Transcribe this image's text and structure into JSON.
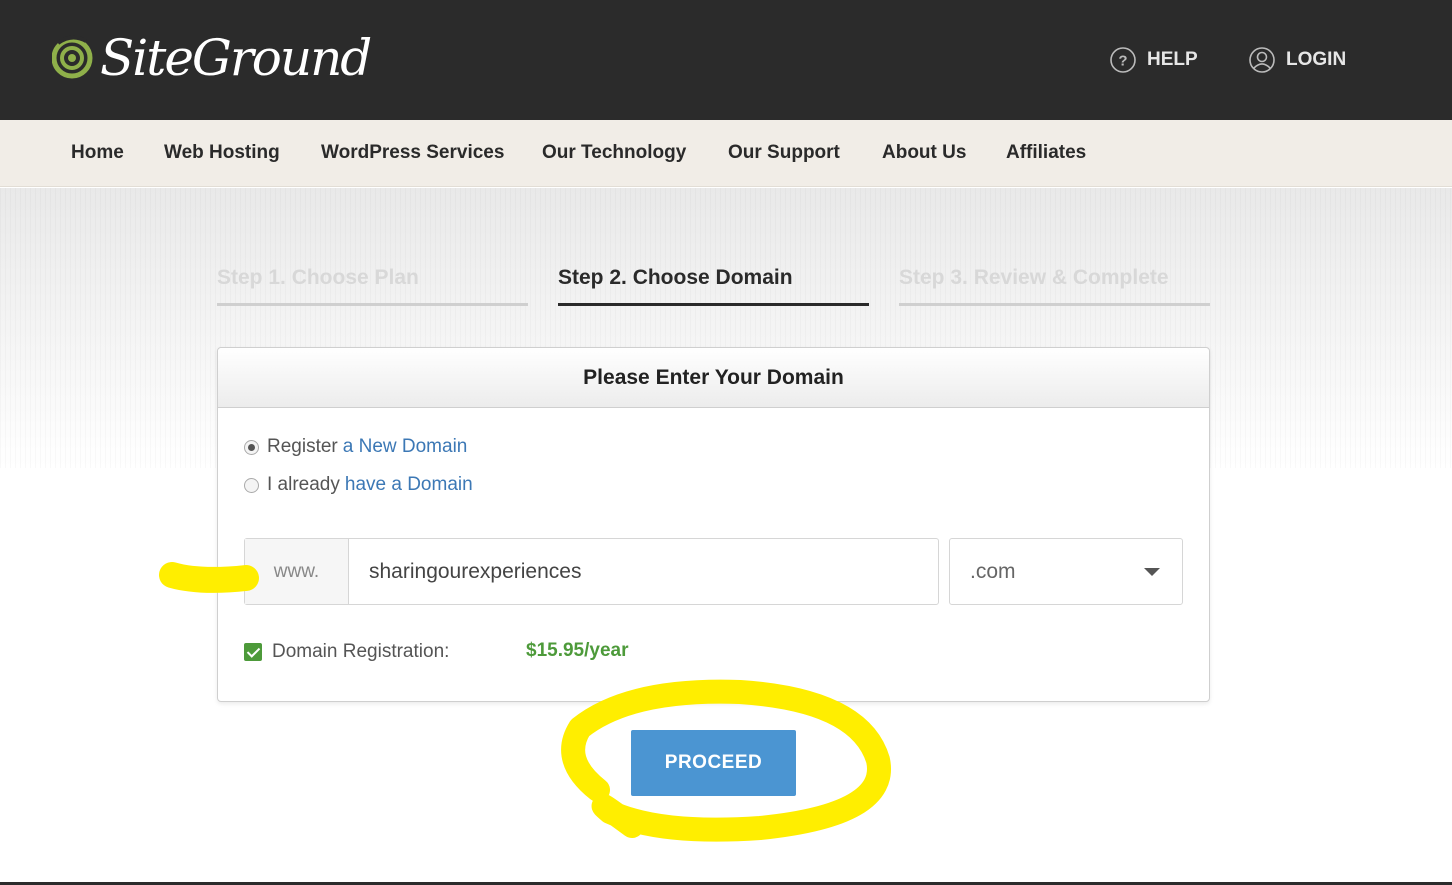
{
  "header": {
    "brand": "SiteGround",
    "help_label": "HELP",
    "login_label": "LOGIN"
  },
  "nav": {
    "items": [
      "Home",
      "Web Hosting",
      "WordPress Services",
      "Our Technology",
      "Our Support",
      "About Us",
      "Affiliates"
    ]
  },
  "steps": [
    {
      "label": "Step 1. Choose Plan",
      "state": "inactive"
    },
    {
      "label": "Step 2. Choose Domain",
      "state": "active"
    },
    {
      "label": "Step 3. Review & Complete",
      "state": "inactive"
    }
  ],
  "panel": {
    "title": "Please Enter Your Domain",
    "options": [
      {
        "prefix": "Register",
        "link": "a New Domain",
        "checked": true
      },
      {
        "prefix": "I already",
        "link": "have a Domain",
        "checked": false
      }
    ],
    "www_prefix": "www.",
    "domain_value": "sharingourexperiences",
    "tld_value": ".com",
    "registration_label": "Domain Registration:",
    "registration_price": "$15.95/year",
    "registration_checked": true
  },
  "actions": {
    "proceed_label": "PROCEED"
  },
  "colors": {
    "topbar": "#2b2b2b",
    "navbar": "#f1ede7",
    "link_blue": "#3c78b5",
    "price_green": "#4d9a3a",
    "button_blue": "#4b95d2",
    "annotation_yellow": "#ffee00"
  },
  "icons": {
    "help": "question-circle-icon",
    "login": "user-circle-icon",
    "logo": "siteground-spiral-logo",
    "tld_dropdown": "caret-down-icon"
  }
}
